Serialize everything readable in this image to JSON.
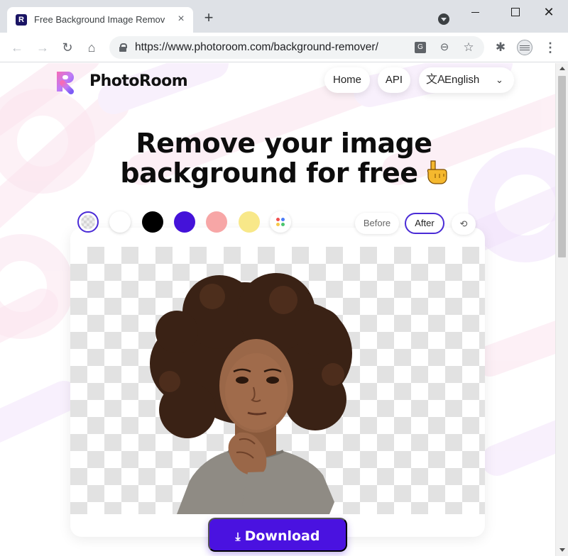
{
  "browser": {
    "tab_title": "Free Background Image Remov",
    "tab_close": "×",
    "new_tab": "+",
    "window_close": "✕",
    "url": "https://www.photoroom.com/background-remover/",
    "nav": {
      "back": "←",
      "forward": "→",
      "reload": "↻",
      "home": "⌂"
    },
    "omnibox_icons": {
      "translate": "G",
      "zoom": "⊖",
      "star": "☆"
    },
    "extensions_icon": "✱",
    "menu_icon": "⋮"
  },
  "site": {
    "brand": "PhotoRoom",
    "favicon_letter": "R",
    "nav": {
      "home": "Home",
      "api": "API",
      "language": "English",
      "language_icon": "文A",
      "chevron": "⌄"
    },
    "headline": {
      "line1": "Remove your image",
      "line2": "background for free"
    }
  },
  "editor": {
    "swatches": [
      {
        "name": "transparent",
        "color": "transparent",
        "selected": true
      },
      {
        "name": "white",
        "color": "#ffffff"
      },
      {
        "name": "black",
        "color": "#000000"
      },
      {
        "name": "purple",
        "color": "#4412d9"
      },
      {
        "name": "pink",
        "color": "#f7a6a6"
      },
      {
        "name": "yellow",
        "color": "#f8e889"
      },
      {
        "name": "more-colors",
        "color": "multi"
      }
    ],
    "before_label": "Before",
    "after_label": "After",
    "view_selected": "After",
    "reset_icon": "⟲",
    "download_label": "Download",
    "download_icon": "⤓"
  },
  "colors": {
    "accent": "#4a12e0",
    "selected_outline": "#4a2bd6",
    "decor_pink": "#fbe3ee",
    "decor_lilac": "#efe0fb"
  }
}
